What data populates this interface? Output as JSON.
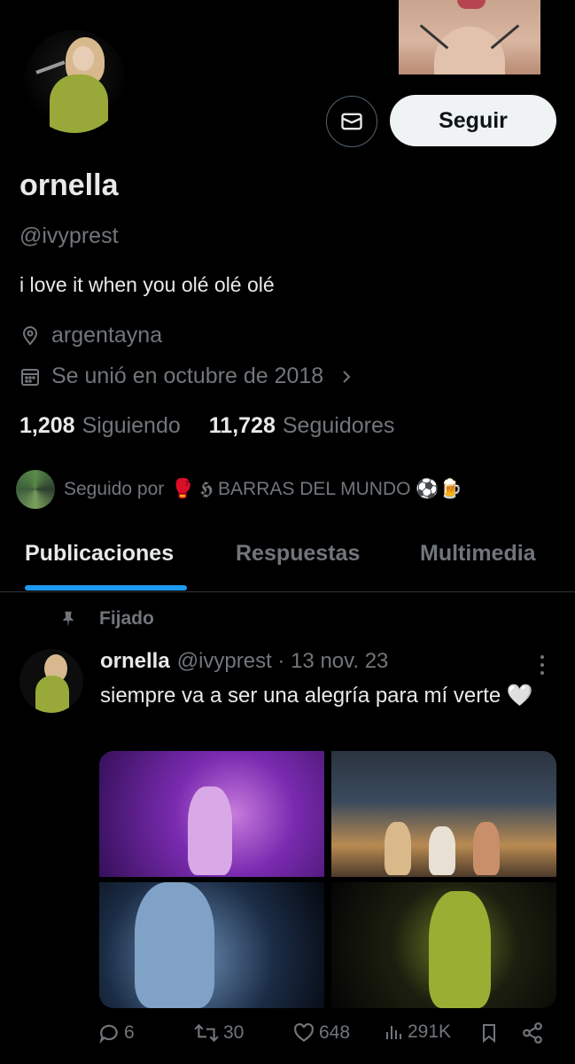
{
  "profile": {
    "display_name": "ornella",
    "handle": "@ivyprest",
    "bio": "i love it when you olé olé olé",
    "location": "argentayna",
    "joined": "Se unió en octubre de 2018",
    "following_count": "1,208",
    "following_label": "Siguiendo",
    "followers_count": "11,728",
    "followers_label": "Seguidores",
    "followed_by_prefix": "Seguido por",
    "followed_by_account": "🥊 𝕳 BARRAS DEL MUNDO ⚽🍺"
  },
  "buttons": {
    "follow_label": "Seguir",
    "message_icon": "mail-icon"
  },
  "tabs": [
    {
      "label": "Publicaciones",
      "active": true
    },
    {
      "label": "Respuestas",
      "active": false
    },
    {
      "label": "Multimedia",
      "active": false
    }
  ],
  "post": {
    "pinned_label": "Fijado",
    "author_name": "ornella",
    "author_handle": "@ivyprest · 13 nov. 23",
    "text": "siempre va a ser una alegría para mí verte 🤍",
    "stats": {
      "replies": "6",
      "reposts": "30",
      "likes": "648",
      "views": "291K"
    }
  },
  "colors": {
    "background": "#000000",
    "text_primary": "#e7e9ea",
    "text_secondary": "#71767b",
    "accent": "#1d9bf0",
    "follow_button_bg": "#eff3f4"
  }
}
